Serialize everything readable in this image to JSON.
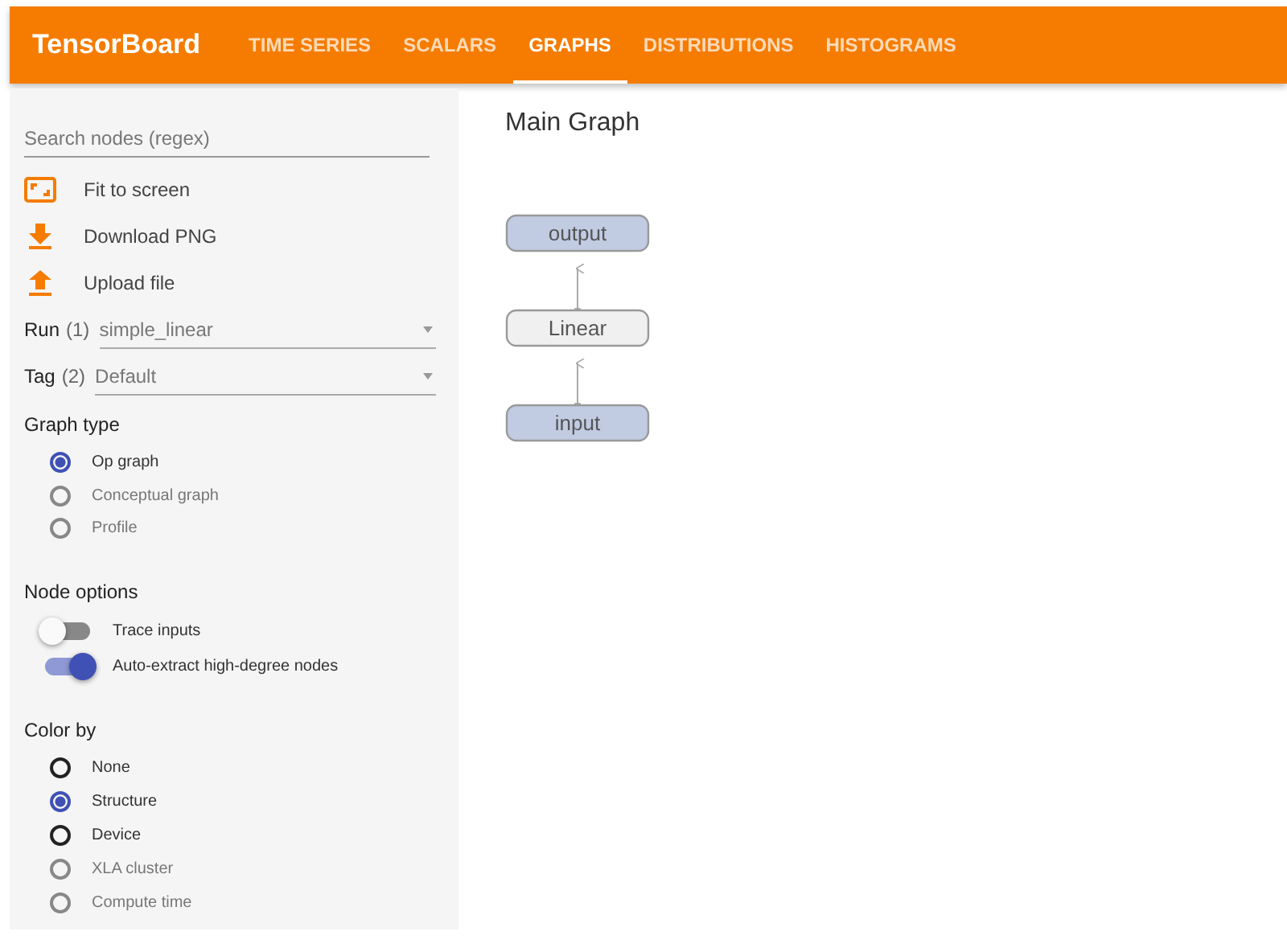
{
  "header": {
    "title": "TensorBoard"
  },
  "tabs": [
    {
      "label": "TIME SERIES",
      "selected": false
    },
    {
      "label": "SCALARS",
      "selected": false
    },
    {
      "label": "GRAPHS",
      "selected": true
    },
    {
      "label": "DISTRIBUTIONS",
      "selected": false
    },
    {
      "label": "HISTOGRAMS",
      "selected": false
    }
  ],
  "sidebar": {
    "search": {
      "placeholder": "Search nodes (regex)"
    },
    "actions": [
      {
        "kind": "fit",
        "label": "Fit to screen"
      },
      {
        "kind": "download",
        "label": "Download PNG"
      },
      {
        "kind": "upload",
        "label": "Upload file"
      }
    ],
    "selects": [
      {
        "label": "Run",
        "count": "(1)",
        "value": "simple_linear"
      },
      {
        "label": "Tag",
        "count": "(2)",
        "value": "Default"
      }
    ],
    "graph_type": {
      "title": "Graph type",
      "options": [
        {
          "label": "Op graph",
          "selected": true,
          "disabled": false
        },
        {
          "label": "Conceptual graph",
          "selected": false,
          "disabled": true
        },
        {
          "label": "Profile",
          "selected": false,
          "disabled": true
        }
      ]
    },
    "node_options": {
      "title": "Node options",
      "toggles": [
        {
          "label": "Trace inputs",
          "on": false
        },
        {
          "label": "Auto-extract high-degree nodes",
          "on": true
        }
      ]
    },
    "color_by": {
      "title": "Color by",
      "options": [
        {
          "label": "None",
          "selected": false,
          "disabled": false
        },
        {
          "label": "Structure",
          "selected": true,
          "disabled": false
        },
        {
          "label": "Device",
          "selected": false,
          "disabled": false
        },
        {
          "label": "XLA cluster",
          "selected": false,
          "disabled": true
        },
        {
          "label": "Compute time",
          "selected": false,
          "disabled": true
        }
      ]
    }
  },
  "main": {
    "title": "Main Graph",
    "nodes": [
      {
        "label": "output",
        "kind": "io"
      },
      {
        "label": "Linear",
        "kind": "op"
      },
      {
        "label": "input",
        "kind": "io"
      }
    ]
  }
}
